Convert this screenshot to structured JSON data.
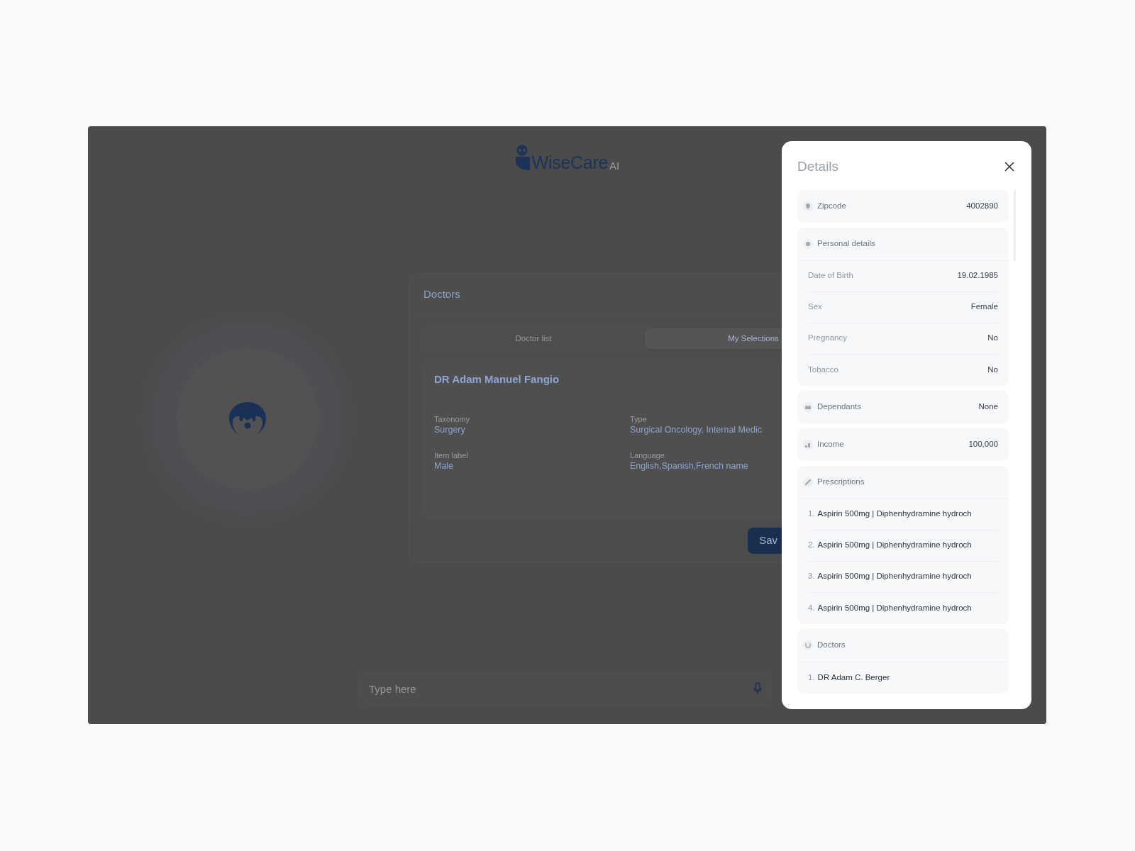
{
  "logo": {
    "name": "WiseCare",
    "suffix": "AI"
  },
  "doctors_card": {
    "title": "Doctors",
    "tabs": [
      {
        "label": "Doctor list",
        "selected": false
      },
      {
        "label": "My Selections",
        "selected": true
      }
    ],
    "doctor": {
      "name": "DR Adam Manuel Fangio",
      "fields": [
        {
          "label": "Taxonomy",
          "value": "Surgery"
        },
        {
          "label": "Type",
          "value": "Surgical Oncology, Internal Medic"
        },
        {
          "label": "Item label",
          "value": "Male"
        },
        {
          "label": "Language",
          "value": "English,Spanish,French name"
        }
      ]
    },
    "save_button": "Sav"
  },
  "chat_input": {
    "placeholder": "Type here"
  },
  "details_panel": {
    "title": "Details",
    "sections": [
      {
        "kind": "pair",
        "label": "Zipcode",
        "value": "4002890"
      },
      {
        "kind": "group",
        "label": "Personal details",
        "rows": [
          {
            "label": "Date of Birth",
            "value": "19.02.1985"
          },
          {
            "label": "Sex",
            "value": "Female"
          },
          {
            "label": "Pregnancy",
            "value": "No"
          },
          {
            "label": "Tobacco",
            "value": "No"
          }
        ]
      },
      {
        "kind": "pair",
        "label": "Dependants",
        "value": "None"
      },
      {
        "kind": "pair",
        "label": "Income",
        "value": "100,000"
      },
      {
        "kind": "list",
        "label": "Prescriptions",
        "items": [
          {
            "number": "1.",
            "text": "Aspirin 500mg | Diphenhydramine hydroch"
          },
          {
            "number": "2.",
            "text": "Aspirin 500mg | Diphenhydramine hydroch"
          },
          {
            "number": "3.",
            "text": "Aspirin 500mg | Diphenhydramine hydroch"
          },
          {
            "number": "4.",
            "text": "Aspirin 500mg | Diphenhydramine hydroch"
          }
        ]
      },
      {
        "kind": "list",
        "label": "Doctors",
        "items": [
          {
            "number": "1.",
            "text": "DR Adam C. Berger"
          }
        ]
      }
    ]
  }
}
